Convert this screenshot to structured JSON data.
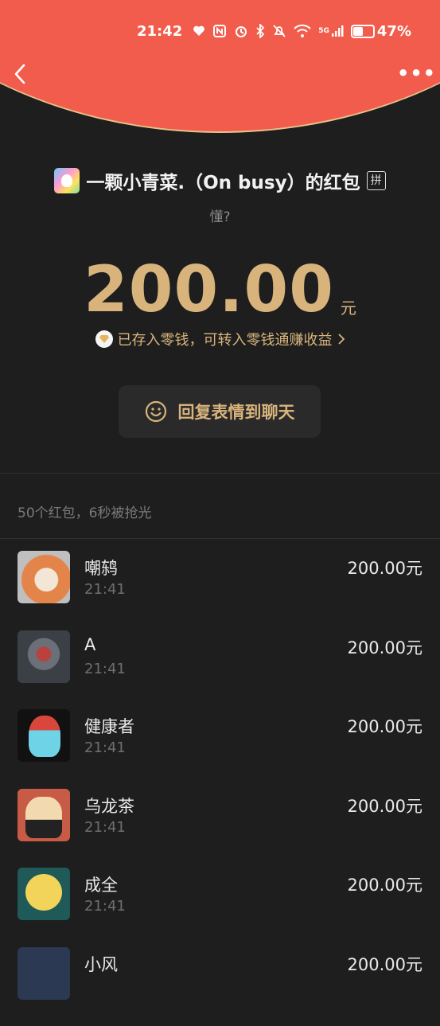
{
  "status_bar": {
    "time": "21:42",
    "network": "5G",
    "battery_percent_text": "47%",
    "battery_level": 0.47
  },
  "nav": {
    "back_icon": "chevron-left-icon",
    "more_label": "•••"
  },
  "envelope": {
    "sender_name": "一颗小青菜.（On busy）的红包",
    "pin_label": "拼",
    "greeting": "懂?",
    "amount": "200.00",
    "unit": "元",
    "note": "已存入零钱，可转入零钱通赚收益",
    "reply_label": "回复表情到聊天"
  },
  "summary": "50个红包，6秒被抢光",
  "recipients": [
    {
      "name": "嘲鸫",
      "time": "21:41",
      "amount": "200.00元"
    },
    {
      "name": "A",
      "time": "21:41",
      "amount": "200.00元"
    },
    {
      "name": "健康者",
      "time": "21:41",
      "amount": "200.00元"
    },
    {
      "name": "乌龙茶",
      "time": "21:41",
      "amount": "200.00元"
    },
    {
      "name": "成全",
      "time": "21:41",
      "amount": "200.00元"
    },
    {
      "name": "小风",
      "time": "",
      "amount": "200.00元"
    }
  ],
  "colors": {
    "header_red": "#f25c4c",
    "gold": "#d8b47c",
    "background": "#1e1e1e"
  }
}
